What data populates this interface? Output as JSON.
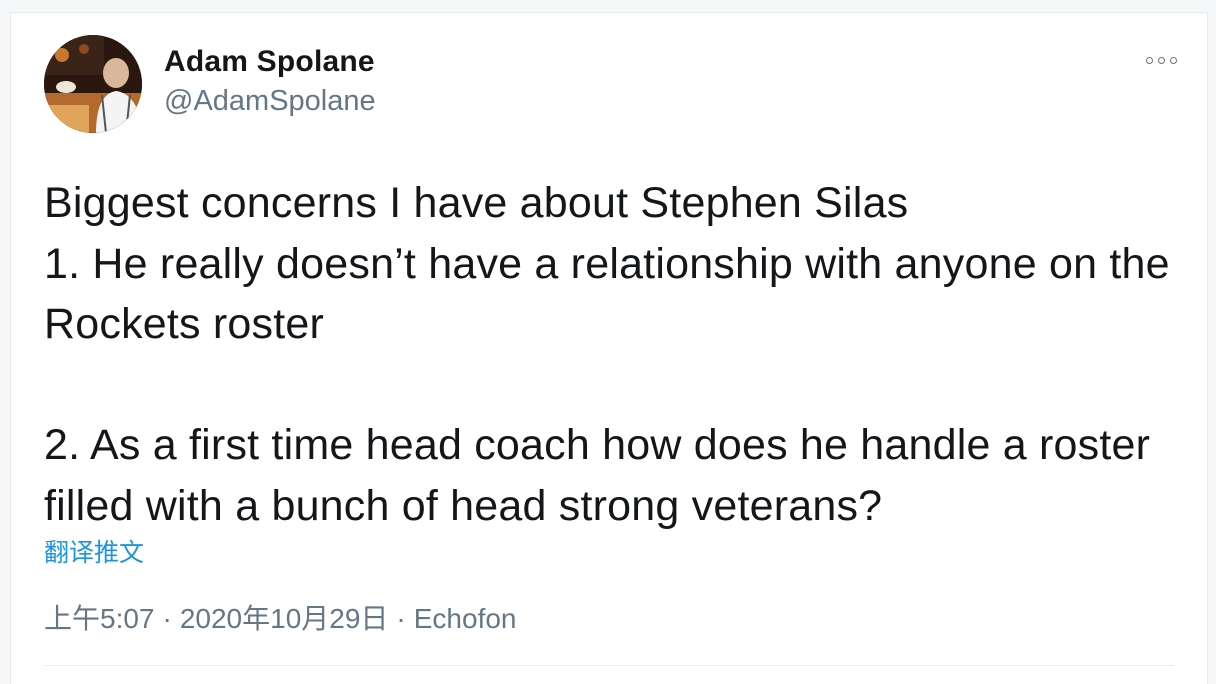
{
  "user": {
    "name": "Adam Spolane",
    "handle": "@AdamSpolane"
  },
  "tweet": {
    "text": "Biggest concerns I have about Stephen Silas\n1. He really doesn’t have a relationship with anyone on the Rockets roster\n\n2. As a first time head coach how does he handle a roster filled with a bunch of head strong veterans?",
    "translate_label": "翻译推文",
    "time": "上午5:07",
    "date": "2020年10月29日",
    "source": "Echofon",
    "separator": "·"
  },
  "icons": {
    "more": "more-options-icon",
    "avatar": "profile-photo"
  },
  "colors": {
    "link": "#1b95e0",
    "secondary_text": "#657786",
    "primary_text": "#14171a"
  }
}
